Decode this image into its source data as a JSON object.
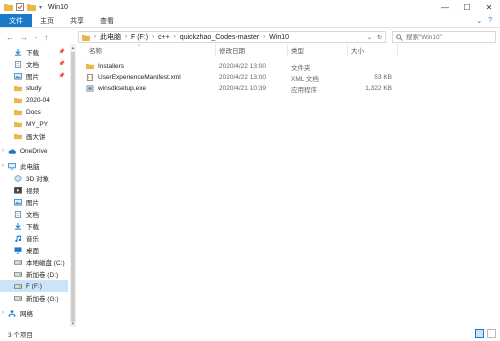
{
  "window": {
    "title": "Win10",
    "controls": {
      "minimize": "—",
      "maximize": "☐",
      "close": "✕"
    }
  },
  "ribbon": {
    "tabs": [
      "文件",
      "主页",
      "共享",
      "查看"
    ],
    "active_tab": 0,
    "expand": "⌄",
    "help": "?"
  },
  "address": {
    "crumbs": [
      "此电脑",
      "F (F:)",
      "c++",
      "quickzhao_Codes-master",
      "Win10"
    ],
    "search_placeholder": "搜索\"Win10\""
  },
  "sidebar": {
    "items": [
      {
        "label": "下载",
        "icon": "download-arrow-icon",
        "color": "#1979ca",
        "pinned": true
      },
      {
        "label": "文档",
        "icon": "document-icon",
        "color": "#6d8fb3",
        "pinned": true
      },
      {
        "label": "图片",
        "icon": "pictures-icon",
        "color": "#4a90c2",
        "pinned": true
      },
      {
        "label": "study",
        "icon": "folder-icon",
        "color": "#e8b84a",
        "pinned": false
      },
      {
        "label": "2020-04",
        "icon": "folder-icon",
        "color": "#e8b84a",
        "pinned": false
      },
      {
        "label": "Docs",
        "icon": "folder-icon",
        "color": "#e8b84a",
        "pinned": false
      },
      {
        "label": "MY_PY",
        "icon": "folder-icon",
        "color": "#e8b84a",
        "pinned": false
      },
      {
        "label": "画大饼",
        "icon": "folder-icon",
        "color": "#e8b84a",
        "pinned": false
      },
      {
        "label": "OneDrive",
        "icon": "cloud-icon",
        "color": "#1979ca",
        "pinned": false
      },
      {
        "label": "此电脑",
        "icon": "computer-icon",
        "color": "#4a90c2",
        "pinned": false
      },
      {
        "label": "3D 对象",
        "icon": "3d-objects-icon",
        "color": "#3aa0d8",
        "pinned": false
      },
      {
        "label": "视频",
        "icon": "video-icon",
        "color": "#555555",
        "pinned": false
      },
      {
        "label": "图片",
        "icon": "pictures-icon",
        "color": "#4a90c2",
        "pinned": false
      },
      {
        "label": "文档",
        "icon": "document-icon",
        "color": "#6d8fb3",
        "pinned": false
      },
      {
        "label": "下载",
        "icon": "download-arrow-icon",
        "color": "#1979ca",
        "pinned": false
      },
      {
        "label": "音乐",
        "icon": "music-icon",
        "color": "#1979ca",
        "pinned": false
      },
      {
        "label": "桌面",
        "icon": "desktop-icon",
        "color": "#1979ca",
        "pinned": false
      },
      {
        "label": "本地磁盘 (C:)",
        "icon": "drive-icon",
        "color": "#777777",
        "pinned": false
      },
      {
        "label": "新加卷 (D:)",
        "icon": "drive-icon",
        "color": "#777777",
        "pinned": false
      },
      {
        "label": "F (F:)",
        "icon": "drive-icon",
        "color": "#777777",
        "pinned": false,
        "selected": true
      },
      {
        "label": "新加卷 (G:)",
        "icon": "drive-icon",
        "color": "#777777",
        "pinned": false
      },
      {
        "label": "网络",
        "icon": "network-icon",
        "color": "#1979ca",
        "pinned": false
      }
    ]
  },
  "columns": {
    "name": "名称",
    "date": "修改日期",
    "type": "类型",
    "size": "大小"
  },
  "files": [
    {
      "name": "Installers",
      "date": "2020/4/22 13:00",
      "type": "文件夹",
      "size": "",
      "icon": "folder-icon"
    },
    {
      "name": "UserExperienceManifest.xml",
      "date": "2020/4/22 13:00",
      "type": "XML 文档",
      "size": "53 KB",
      "icon": "xml-file-icon"
    },
    {
      "name": "winsdksetup.exe",
      "date": "2020/4/21 10:39",
      "type": "应用程序",
      "size": "1,322 KB",
      "icon": "installer-exe-icon"
    }
  ],
  "status": {
    "count": "3 个项目"
  },
  "colors": {
    "accent": "#1979ca",
    "selection": "#cce4f7",
    "folder": "#e8b84a"
  }
}
